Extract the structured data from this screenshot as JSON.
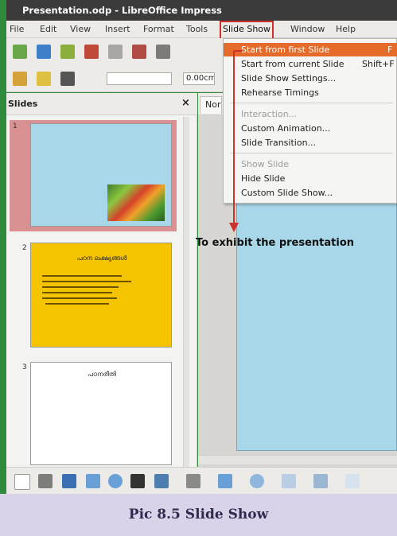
{
  "window": {
    "title": "Presentation.odp - LibreOffice Impress"
  },
  "menubar": {
    "items": [
      "File",
      "Edit",
      "View",
      "Insert",
      "Format",
      "Tools",
      "Slide Show",
      "Window",
      "Help"
    ],
    "active": "Slide Show"
  },
  "toolbar": {
    "line_width_value": "0.00cm"
  },
  "dropdown": {
    "items": [
      {
        "label": "Start from first Slide",
        "shortcut": "F",
        "state": "highlighted"
      },
      {
        "label": "Start from current Slide",
        "shortcut": "Shift+F",
        "state": "normal"
      },
      {
        "label": "Slide Show Settings...",
        "shortcut": "",
        "state": "normal"
      },
      {
        "label": "Rehearse Timings",
        "shortcut": "",
        "state": "normal"
      },
      {
        "label": "Interaction...",
        "shortcut": "",
        "state": "disabled"
      },
      {
        "label": "Custom Animation...",
        "shortcut": "",
        "state": "normal"
      },
      {
        "label": "Slide Transition...",
        "shortcut": "",
        "state": "normal"
      },
      {
        "label": "Show Slide",
        "shortcut": "",
        "state": "disabled"
      },
      {
        "label": "Hide Slide",
        "shortcut": "",
        "state": "normal"
      },
      {
        "label": "Custom Slide Show...",
        "shortcut": "",
        "state": "normal"
      }
    ]
  },
  "slides_pane": {
    "title": "Slides",
    "close_glyph": "×",
    "slides": [
      {
        "number": "1"
      },
      {
        "number": "2",
        "title": "പഠന ലക്ഷ്യങ്ങൾ"
      },
      {
        "number": "3",
        "title": "പഠനരീതി"
      }
    ]
  },
  "workarea": {
    "tab_label": "Nor"
  },
  "annotation": {
    "text": "To exhibit the presentation"
  },
  "caption": {
    "text": "Pic 8.5 Slide Show"
  },
  "colors": {
    "accent_red": "#d0302b",
    "highlight_orange": "#e56b2a",
    "slide_blue": "#a9d7ea",
    "slide_yellow": "#f5c400",
    "caption_bg": "#d9d3ea"
  }
}
